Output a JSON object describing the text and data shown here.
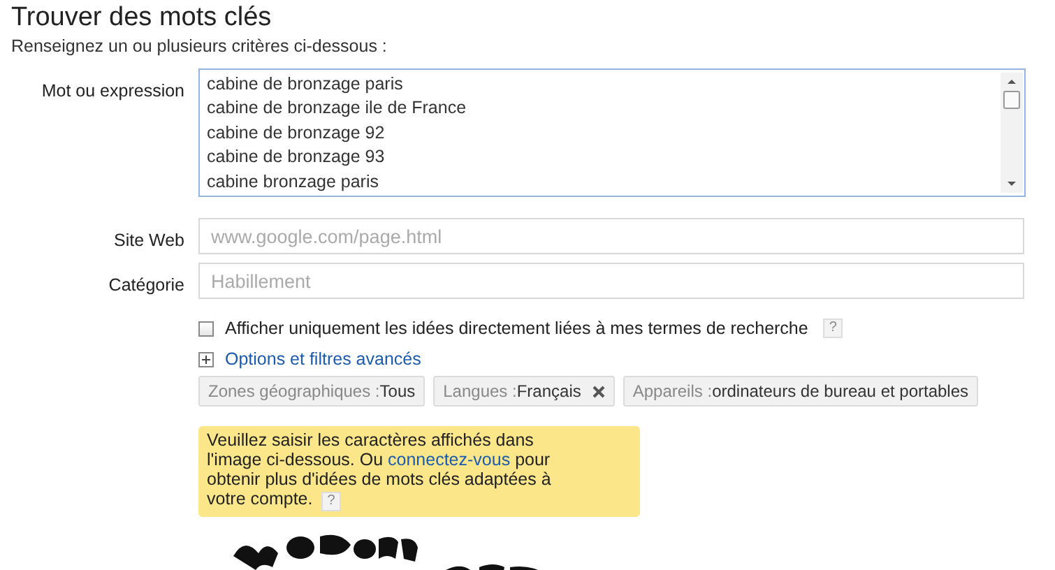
{
  "title": "Trouver des mots clés",
  "subtitle": "Renseignez un ou plusieurs critères ci-dessous :",
  "fields": [
    {
      "kind": "list",
      "label": "Mot ou expression",
      "lines": [
        "cabine de bronzage paris",
        "cabine de bronzage ile de France",
        "cabine de bronzage 92",
        "cabine de bronzage 93",
        "cabine bronzage paris"
      ]
    },
    {
      "kind": "text",
      "label": "Site Web",
      "placeholder": "www.google.com/page.html"
    },
    {
      "kind": "text",
      "label": "Catégorie",
      "placeholder": "Habillement"
    }
  ],
  "only_related": {
    "label": "Afficher uniquement les idées directement liées à mes termes de recherche",
    "checked": false,
    "help": "?"
  },
  "advanced": {
    "label": "Options et filtres avancés",
    "expanded": false
  },
  "filters": [
    {
      "label": "Zones géographiques :",
      "value": "Tous",
      "removable": false
    },
    {
      "label": "Langues :",
      "value": "Français",
      "removable": true
    },
    {
      "label": "Appareils :",
      "value": "ordinateurs de bureau et portables",
      "removable": false
    }
  ],
  "notice": {
    "before": "Veuillez saisir les caractères affichés dans l'image ci-dessous. Ou ",
    "link": "connectez-vous",
    "after": " pour obtenir plus d'idées de mots clés adaptées à votre compte.",
    "help": "?"
  }
}
